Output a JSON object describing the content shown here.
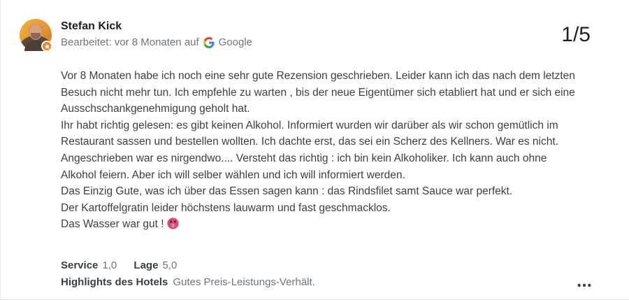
{
  "reviewer": {
    "name": "Stefan Kick",
    "meta_prefix": "Bearbeitet: vor 8 Monaten auf",
    "source": "Google"
  },
  "counter": "1/5",
  "review": {
    "paragraphs": [
      "Vor 8 Monaten habe ich noch eine sehr gute Rezension geschrieben. Leider kann ich das nach dem letzten Besuch nicht mehr tun. Ich empfehle zu warten , bis der neue Eigentümer sich etabliert hat und er sich eine Ausschschankgenehmigung geholt hat.",
      "Ihr habt richtig gelesen: es gibt keinen Alkohol. Informiert wurden wir darüber als wir schon gemütlich im Restaurant sassen und bestellen wollten. Ich dachte erst, das sei ein Scherz des Kellners. War es nicht. Angeschrieben war es nirgendwo.... Versteht das richtig : ich bin kein Alkoholiker. Ich kann auch ohne Alkohol feiern. Aber ich will selber wählen und ich will informiert werden.",
      "Das Einzig Gute, was ich über das Essen sagen kann : das Rindsfilet samt Sauce war perfekt.",
      "Der Kartoffelgratin leider höchstens lauwarm und fast geschmacklos.",
      "Das Wasser war gut !"
    ]
  },
  "ratings": {
    "service_label": "Service",
    "service_value": "1,0",
    "lage_label": "Lage",
    "lage_value": "5,0"
  },
  "highlights": {
    "label": "Highlights des Hotels",
    "value": "Gutes Preis-Leistungs-Verhält."
  },
  "icons": {
    "avatar": "profile-photo",
    "badge": "local-guide-star-icon",
    "source_logo": "google-g-icon",
    "emoji": "grinning-tongue-emoji-icon",
    "more": "more-horizontal-icon"
  },
  "colors": {
    "badge": "#f97b22",
    "secondary_text": "#70757a",
    "body_text": "#3c4043"
  }
}
